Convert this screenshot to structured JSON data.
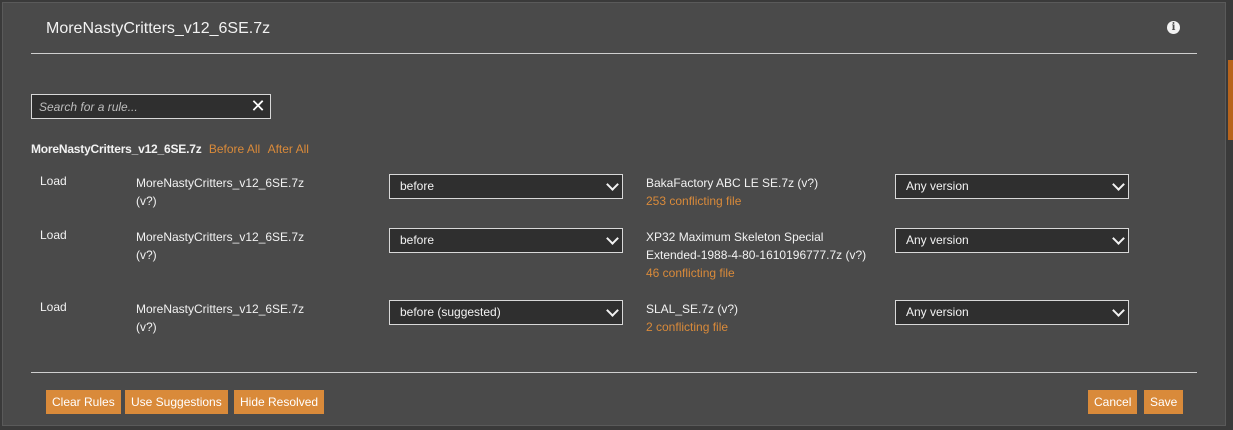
{
  "dialog": {
    "title": "MoreNastyCritters_v12_6SE.7z",
    "info_icon": "info-icon"
  },
  "search": {
    "placeholder": "Search for a rule...",
    "value": ""
  },
  "mod": {
    "name": "MoreNastyCritters_v12_6SE.7z",
    "before_all": "Before All",
    "after_all": "After All"
  },
  "rules": [
    {
      "type": "Load",
      "source_line1": "MoreNastyCritters_v12_6SE.7z",
      "source_line2": "(v?)",
      "relation": "before",
      "target_line1": "BakaFactory ABC LE SE.7z (v?)",
      "target_line2": "",
      "conflicts": "253 conflicting file",
      "version": "Any version"
    },
    {
      "type": "Load",
      "source_line1": "MoreNastyCritters_v12_6SE.7z",
      "source_line2": "(v?)",
      "relation": "before",
      "target_line1": "XP32 Maximum Skeleton Special",
      "target_line2": "Extended-1988-4-80-1610196777.7z (v?)",
      "conflicts": "46 conflicting file",
      "version": "Any version"
    },
    {
      "type": "Load",
      "source_line1": "MoreNastyCritters_v12_6SE.7z",
      "source_line2": "(v?)",
      "relation": "before (suggested)",
      "target_line1": "SLAL_SE.7z (v?)",
      "target_line2": "",
      "conflicts": "2 conflicting file",
      "version": "Any version"
    }
  ],
  "footer": {
    "clear_rules": "Clear Rules",
    "use_suggestions": "Use Suggestions",
    "hide_resolved": "Hide Resolved",
    "cancel": "Cancel",
    "save": "Save"
  },
  "colors": {
    "accent": "#d98a3a",
    "panel": "#4a4a4a",
    "field": "#2f2f2f"
  }
}
